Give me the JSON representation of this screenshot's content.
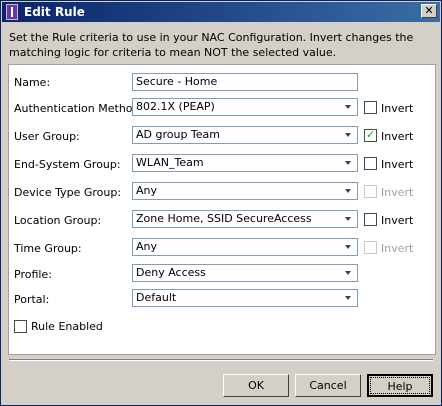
{
  "window": {
    "title": "Edit Rule",
    "close_glyph": "✕",
    "icon": "app-icon"
  },
  "description": "Set the Rule criteria to use in your NAC Configuration. Invert changes the matching logic for criteria to mean NOT the selected value.",
  "form": {
    "name": {
      "label": "Name:",
      "value": "Secure - Home"
    },
    "auth_method": {
      "label": "Authentication Method:",
      "value": "802.1X (PEAP)",
      "invert_label": "Invert",
      "invert_checked": false,
      "invert_enabled": true
    },
    "user_group": {
      "label": "User Group:",
      "value": "AD group Team",
      "invert_label": "Invert",
      "invert_checked": true,
      "invert_enabled": true
    },
    "end_system_group": {
      "label": "End-System Group:",
      "value": "WLAN_Team",
      "invert_label": "Invert",
      "invert_checked": false,
      "invert_enabled": true
    },
    "device_type_group": {
      "label": "Device Type Group:",
      "value": "Any",
      "invert_label": "Invert",
      "invert_checked": false,
      "invert_enabled": false
    },
    "location_group": {
      "label": "Location Group:",
      "value": "Zone Home, SSID SecureAccess",
      "invert_label": "Invert",
      "invert_checked": false,
      "invert_enabled": true
    },
    "time_group": {
      "label": "Time Group:",
      "value": "Any",
      "invert_label": "Invert",
      "invert_checked": false,
      "invert_enabled": false
    },
    "profile": {
      "label": "Profile:",
      "value": "Deny Access"
    },
    "portal": {
      "label": "Portal:",
      "value": "Default"
    },
    "rule_enabled": {
      "label": "Rule Enabled",
      "checked": false
    }
  },
  "buttons": {
    "ok": "OK",
    "cancel": "Cancel",
    "help": "Help"
  },
  "colors": {
    "titlebar_start": "#0a246a",
    "titlebar_end": "#3a6ea5",
    "check_green": "#21a121",
    "dialog_bg": "#d4d0c8"
  }
}
